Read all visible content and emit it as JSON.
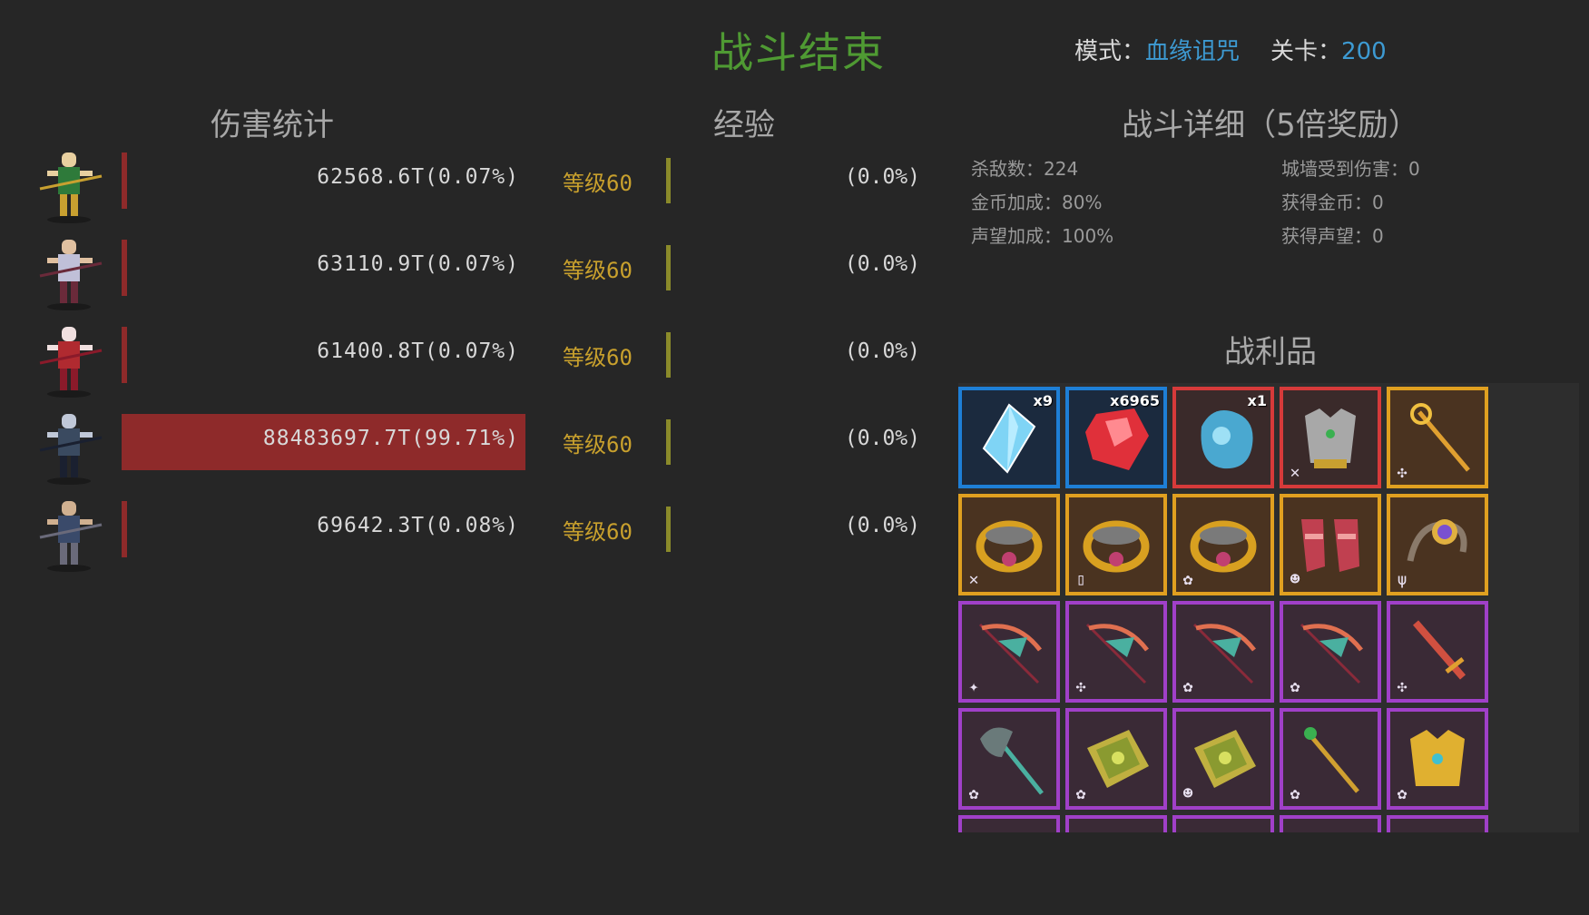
{
  "title": "战斗结束",
  "mode": {
    "label": "模式：",
    "value": "血缘诅咒"
  },
  "stage": {
    "label": "关卡：",
    "value": "200"
  },
  "headings": {
    "damage": "伤害统计",
    "exp": "经验",
    "detail": "战斗详细（5倍奖励）",
    "loot": "战利品"
  },
  "heroes": [
    {
      "damage": "62568.6T(0.07%)",
      "share": 0.0007,
      "level": "等级60",
      "exp": "(0.0%)",
      "icon": "archer-elf-icon"
    },
    {
      "damage": "63110.9T(0.07%)",
      "share": 0.0007,
      "level": "等级60",
      "exp": "(0.0%)",
      "icon": "blade-dancer-icon"
    },
    {
      "damage": "61400.8T(0.07%)",
      "share": 0.0007,
      "level": "等级60",
      "exp": "(0.0%)",
      "icon": "sorceress-icon"
    },
    {
      "damage": "88483697.7T(99.71%)",
      "share": 0.9971,
      "level": "等级60",
      "exp": "(0.0%)",
      "icon": "dark-knight-icon"
    },
    {
      "damage": "69642.3T(0.08%)",
      "share": 0.0008,
      "level": "等级60",
      "exp": "(0.0%)",
      "icon": "swordsman-icon"
    }
  ],
  "detail": {
    "kills": "杀敌数：224",
    "gold_bonus": "金币加成：80%",
    "fame_bonus": "声望加成：100%",
    "wall_damage": "城墙受到伤害：0",
    "gold_gained": "获得金币：0",
    "fame_gained": "获得声望：0"
  },
  "loot": [
    {
      "rarity": "blue",
      "icon": "blue-crystal-icon",
      "qty": "x9",
      "color": "#7fd4f5",
      "badge": ""
    },
    {
      "rarity": "blue",
      "icon": "red-gem-icon",
      "qty": "x6965",
      "color": "#e0303a",
      "badge": ""
    },
    {
      "rarity": "red",
      "icon": "blue-ore-icon",
      "qty": "x1",
      "color": "#4aa8d0",
      "badge": ""
    },
    {
      "rarity": "red",
      "icon": "chest-armor-icon",
      "qty": "",
      "color": "#a8a8a8",
      "badge": "bow"
    },
    {
      "rarity": "gold",
      "icon": "staff-icon",
      "qty": "",
      "color": "#e0a030",
      "badge": "wing"
    },
    {
      "rarity": "gold",
      "icon": "ring-icon",
      "qty": "",
      "color": "#d8a020",
      "badge": "bow"
    },
    {
      "rarity": "gold",
      "icon": "ring-icon",
      "qty": "",
      "color": "#d8a020",
      "badge": "sword"
    },
    {
      "rarity": "gold",
      "icon": "ring-icon",
      "qty": "",
      "color": "#d8a020",
      "badge": "flower"
    },
    {
      "rarity": "gold",
      "icon": "boots-icon",
      "qty": "",
      "color": "#c04050",
      "badge": "mask"
    },
    {
      "rarity": "gold",
      "icon": "amulet-icon",
      "qty": "",
      "color": "#e0b040",
      "badge": "trident"
    },
    {
      "rarity": "purple",
      "icon": "crossbow-icon",
      "qty": "",
      "color": "#e07050",
      "badge": "star"
    },
    {
      "rarity": "purple",
      "icon": "crossbow-icon",
      "qty": "",
      "color": "#e07050",
      "badge": "wing"
    },
    {
      "rarity": "purple",
      "icon": "crossbow-icon",
      "qty": "",
      "color": "#e07050",
      "badge": "flower"
    },
    {
      "rarity": "purple",
      "icon": "crossbow-icon",
      "qty": "",
      "color": "#e07050",
      "badge": "flower"
    },
    {
      "rarity": "purple",
      "icon": "sword-icon",
      "qty": "",
      "color": "#d05040",
      "badge": "wing"
    },
    {
      "rarity": "purple",
      "icon": "axe-icon",
      "qty": "",
      "color": "#50c0b0",
      "badge": "flower"
    },
    {
      "rarity": "purple",
      "icon": "spellbook-icon",
      "qty": "",
      "color": "#c0b040",
      "badge": "flower"
    },
    {
      "rarity": "purple",
      "icon": "spellbook-icon",
      "qty": "",
      "color": "#c0b040",
      "badge": "mask"
    },
    {
      "rarity": "purple",
      "icon": "wand-icon",
      "qty": "",
      "color": "#d0a030",
      "badge": "flower"
    },
    {
      "rarity": "purple",
      "icon": "gold-armor-icon",
      "qty": "",
      "color": "#e0b030",
      "badge": "flower"
    },
    {
      "rarity": "purple",
      "icon": "item-icon",
      "qty": "",
      "color": "#c08030",
      "badge": ""
    },
    {
      "rarity": "purple",
      "icon": "item-icon",
      "qty": "",
      "color": "#c08030",
      "badge": ""
    },
    {
      "rarity": "purple",
      "icon": "item-icon",
      "qty": "",
      "color": "#c08030",
      "badge": ""
    },
    {
      "rarity": "purple",
      "icon": "item-icon",
      "qty": "",
      "color": "#c08030",
      "badge": ""
    },
    {
      "rarity": "purple",
      "icon": "item-icon",
      "qty": "",
      "color": "#c08030",
      "badge": ""
    }
  ]
}
